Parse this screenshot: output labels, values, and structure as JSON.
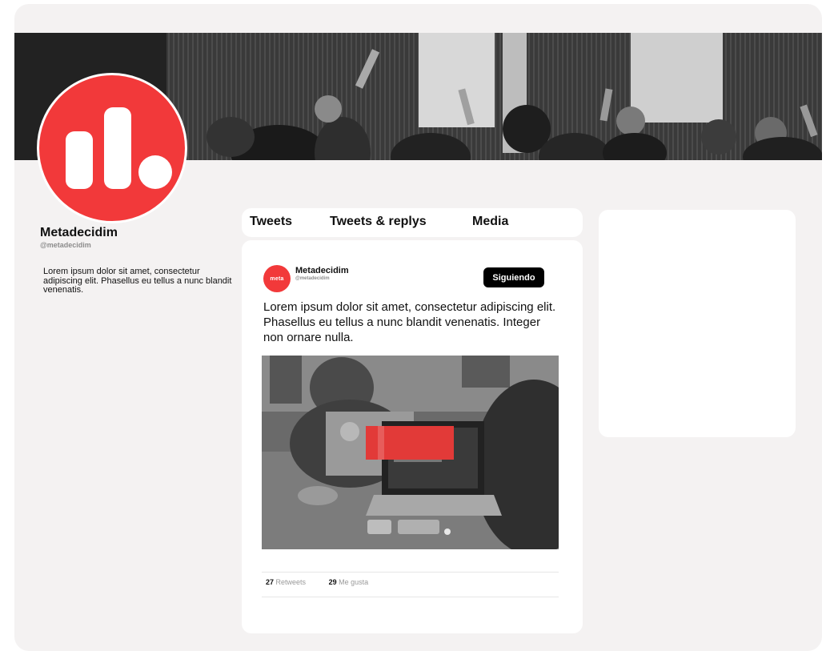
{
  "profile": {
    "name": "Metadecidim",
    "handle": "@metadecidim",
    "bio": "Lorem ipsum dolor sit amet, consectetur adipiscing elit. Phasellus eu tellus a nunc blandit venenatis.",
    "avatar_icon": "metadecidim-logo-icon",
    "banner": "audience-raising-hands-photo"
  },
  "tabs": [
    {
      "label": "Tweets"
    },
    {
      "label": "Tweets & replys"
    },
    {
      "label": "Media"
    }
  ],
  "tweet": {
    "avatar_text": "meta",
    "author": "Metadecidim",
    "handle": "@metadecidim",
    "follow_label": "Siguiendo",
    "text": "Lorem ipsum dolor sit amet, consectetur adipiscing elit. Phasellus eu tellus a nunc blandit venenatis. Integer non ornare nulla.",
    "image": "lab-laptop-photo",
    "retweets_count": "27",
    "retweets_label": "Retweets",
    "likes_count": "29",
    "likes_label": "Me gusta"
  },
  "colors": {
    "brand_red": "#f2393a",
    "page_bg": "#f4f2f2",
    "card_bg": "#ffffff",
    "button_bg": "#000000"
  }
}
